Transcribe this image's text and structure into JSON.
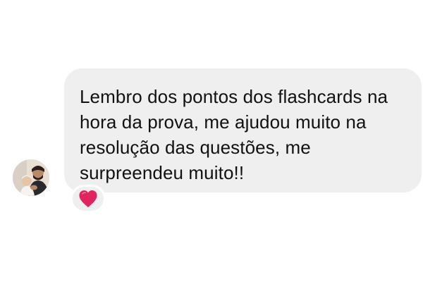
{
  "message": {
    "text": "Lembro dos pontos dos flashcards na hora da prova, me ajudou muito na resolução das questões, me surpreendeu muito!!"
  },
  "reaction": {
    "icon": "heart-icon",
    "color": "#e0245e"
  },
  "colors": {
    "bubble": "#efefef",
    "text": "#111111",
    "background": "#ffffff"
  }
}
